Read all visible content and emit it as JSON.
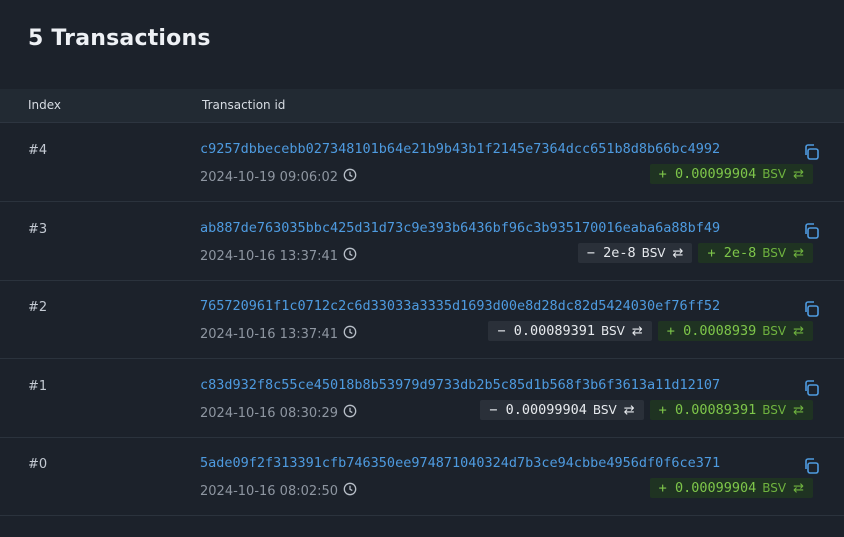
{
  "header": {
    "title": "5 Transactions"
  },
  "table": {
    "columns": {
      "index": "Index",
      "transaction_id": "Transaction id"
    },
    "rows": [
      {
        "index": "#4",
        "txid": "c9257dbbecebb027348101b64e21b9b43b1f2145e7364dcc651b8d8b66bc4992",
        "time": "2024-10-19 09:06:02",
        "amounts": [
          {
            "sign": "+",
            "value": "0.00099904",
            "unit": "BSV",
            "kind": "pos"
          }
        ]
      },
      {
        "index": "#3",
        "txid": "ab887de763035bbc425d31d73c9e393b6436bf96c3b935170016eaba6a88bf49",
        "time": "2024-10-16 13:37:41",
        "amounts": [
          {
            "sign": "−",
            "value": "2e-8",
            "unit": "BSV",
            "kind": "neg"
          },
          {
            "sign": "+",
            "value": "2e-8",
            "unit": "BSV",
            "kind": "pos"
          }
        ]
      },
      {
        "index": "#2",
        "txid": "765720961f1c0712c2c6d33033a3335d1693d00e8d28dc82d5424030ef76ff52",
        "time": "2024-10-16 13:37:41",
        "amounts": [
          {
            "sign": "−",
            "value": "0.00089391",
            "unit": "BSV",
            "kind": "neg"
          },
          {
            "sign": "+",
            "value": "0.0008939",
            "unit": "BSV",
            "kind": "pos"
          }
        ]
      },
      {
        "index": "#1",
        "txid": "c83d932f8c55ce45018b8b53979d9733db2b5c85d1b568f3b6f3613a11d12107",
        "time": "2024-10-16 08:30:29",
        "amounts": [
          {
            "sign": "−",
            "value": "0.00099904",
            "unit": "BSV",
            "kind": "neg"
          },
          {
            "sign": "+",
            "value": "0.00089391",
            "unit": "BSV",
            "kind": "pos"
          }
        ]
      },
      {
        "index": "#0",
        "txid": "5ade09f2f313391cfb746350ee974871040324d7b3ce94cbbe4956df0f6ce371",
        "time": "2024-10-16 08:02:50",
        "amounts": [
          {
            "sign": "+",
            "value": "0.00099904",
            "unit": "BSV",
            "kind": "pos"
          }
        ]
      }
    ]
  },
  "icons": {
    "copy": "copy-icon",
    "clock": "clock-icon",
    "swap": "swap-arrows-icon"
  },
  "colors": {
    "link": "#4e9be0",
    "positive": "#7ec64a",
    "positive_bg": "#1f3322",
    "negative_bg": "#2a3039",
    "background": "#1c222b"
  }
}
